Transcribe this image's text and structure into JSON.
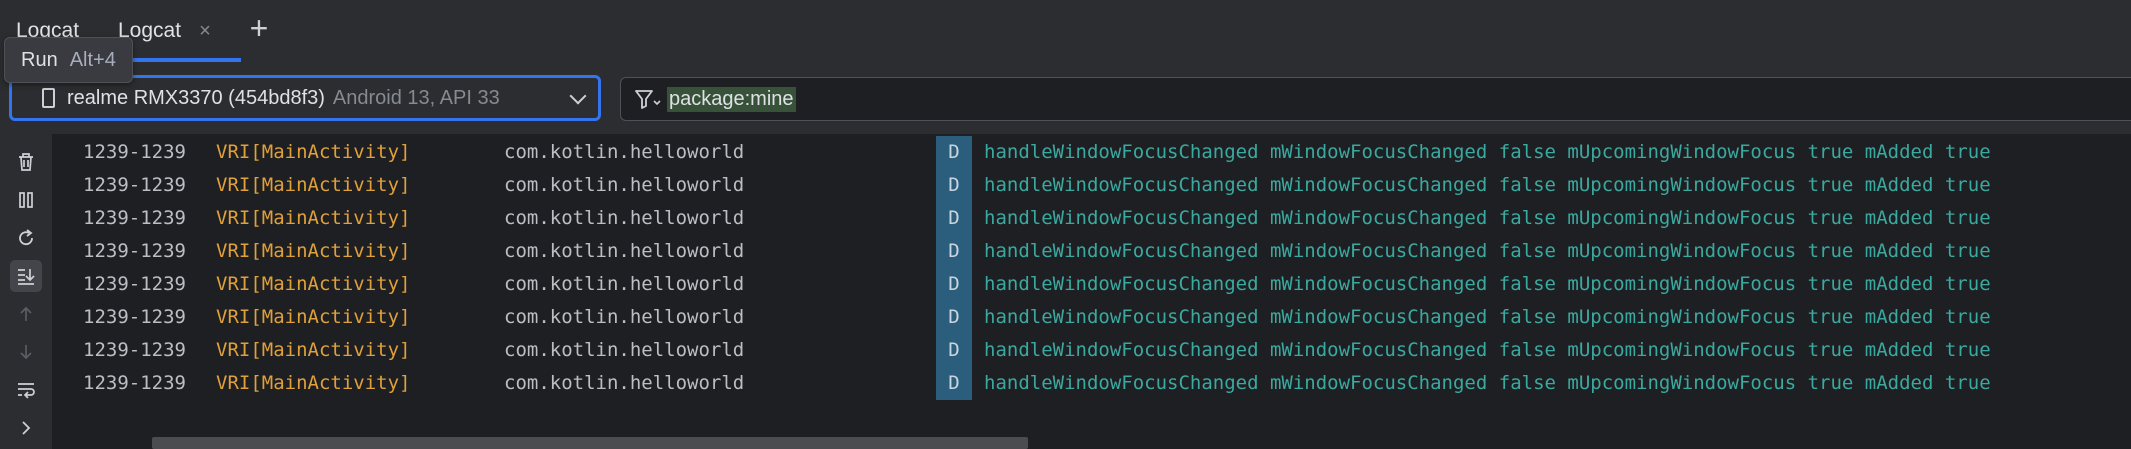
{
  "tabs": [
    {
      "label": "Logcat"
    },
    {
      "label": "Logcat",
      "close": "×"
    }
  ],
  "add_tab_symbol": "+",
  "tooltip": {
    "label": "Run",
    "shortcut": "Alt+4"
  },
  "device": {
    "name": "realme RMX3370 (454bd8f3)",
    "api": "Android 13, API 33"
  },
  "filter": {
    "value": "package:mine"
  },
  "side_toolbar_icons": [
    "trash-icon",
    "pause-icon",
    "restart-icon",
    "scroll-to-end-icon",
    "up-arrow-icon",
    "down-arrow-icon",
    "soft-wrap-icon",
    "expand-icon"
  ],
  "log_rows": [
    {
      "pid": "1239-1239",
      "tag": "VRI[MainActivity]",
      "package": "com.kotlin.helloworld",
      "level": "D",
      "message": "handleWindowFocusChanged mWindowFocusChanged false mUpcomingWindowFocus true mAdded true"
    },
    {
      "pid": "1239-1239",
      "tag": "VRI[MainActivity]",
      "package": "com.kotlin.helloworld",
      "level": "D",
      "message": "handleWindowFocusChanged mWindowFocusChanged false mUpcomingWindowFocus true mAdded true"
    },
    {
      "pid": "1239-1239",
      "tag": "VRI[MainActivity]",
      "package": "com.kotlin.helloworld",
      "level": "D",
      "message": "handleWindowFocusChanged mWindowFocusChanged false mUpcomingWindowFocus true mAdded true"
    },
    {
      "pid": "1239-1239",
      "tag": "VRI[MainActivity]",
      "package": "com.kotlin.helloworld",
      "level": "D",
      "message": "handleWindowFocusChanged mWindowFocusChanged false mUpcomingWindowFocus true mAdded true"
    },
    {
      "pid": "1239-1239",
      "tag": "VRI[MainActivity]",
      "package": "com.kotlin.helloworld",
      "level": "D",
      "message": "handleWindowFocusChanged mWindowFocusChanged false mUpcomingWindowFocus true mAdded true"
    },
    {
      "pid": "1239-1239",
      "tag": "VRI[MainActivity]",
      "package": "com.kotlin.helloworld",
      "level": "D",
      "message": "handleWindowFocusChanged mWindowFocusChanged false mUpcomingWindowFocus true mAdded true"
    },
    {
      "pid": "1239-1239",
      "tag": "VRI[MainActivity]",
      "package": "com.kotlin.helloworld",
      "level": "D",
      "message": "handleWindowFocusChanged mWindowFocusChanged false mUpcomingWindowFocus true mAdded true"
    },
    {
      "pid": "1239-1239",
      "tag": "VRI[MainActivity]",
      "package": "com.kotlin.helloworld",
      "level": "D",
      "message": "handleWindowFocusChanged mWindowFocusChanged false mUpcomingWindowFocus true mAdded true"
    }
  ],
  "colors": {
    "accent": "#3574f0",
    "tag": "#e0a03a",
    "message": "#3aa9a0",
    "level_debug_bg": "#2b5d7c",
    "filter_highlight": "#375239"
  }
}
